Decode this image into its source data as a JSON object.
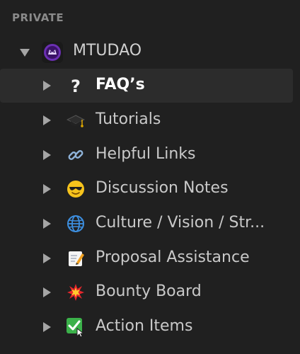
{
  "sidebar": {
    "section_title": "PRIVATE",
    "workspace": {
      "label": "MTUDAO",
      "icon": "mtudao-logo-icon"
    },
    "items": [
      {
        "label": "FAQ’s",
        "icon": "question-mark-icon",
        "selected": true
      },
      {
        "label": "Tutorials",
        "icon": "graduation-cap-icon",
        "selected": false
      },
      {
        "label": "Helpful Links",
        "icon": "link-icon",
        "selected": false
      },
      {
        "label": "Discussion Notes",
        "icon": "sunglasses-face-icon",
        "selected": false
      },
      {
        "label": "Culture / Vision / Str...",
        "icon": "globe-icon",
        "selected": false
      },
      {
        "label": "Proposal Assistance",
        "icon": "memo-icon",
        "selected": false
      },
      {
        "label": "Bounty Board",
        "icon": "collision-icon",
        "selected": false
      },
      {
        "label": "Action Items",
        "icon": "checkbox-icon",
        "selected": false
      }
    ]
  }
}
